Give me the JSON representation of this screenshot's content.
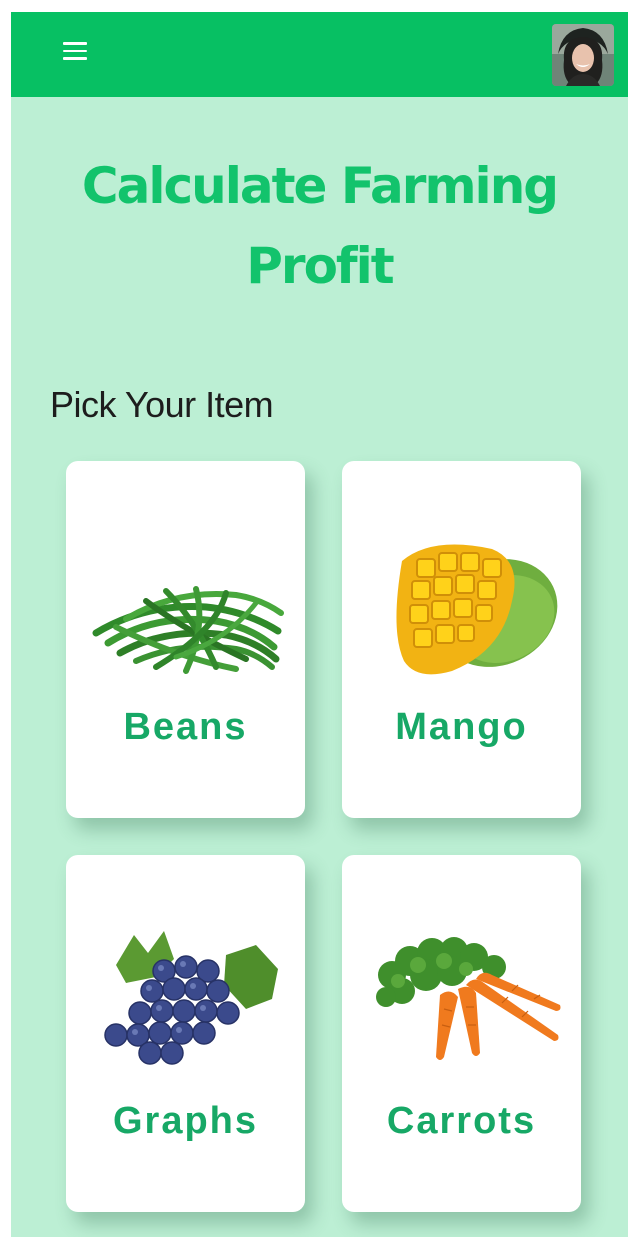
{
  "header": {
    "menu_icon": "hamburger-menu-icon",
    "avatar_icon": "user-avatar-photo",
    "bar_color": "#07c063"
  },
  "page": {
    "title": "Calculate Farming\nProfit",
    "subtitle": "Pick Your Item",
    "background": "#bcefd4",
    "accent": "#12c36c"
  },
  "items": [
    {
      "label": "Beans",
      "image": "green-beans-image"
    },
    {
      "label": "Mango",
      "image": "mango-image"
    },
    {
      "label": "Graphs",
      "image": "grapes-image"
    },
    {
      "label": "Carrots",
      "image": "carrots-image"
    }
  ]
}
